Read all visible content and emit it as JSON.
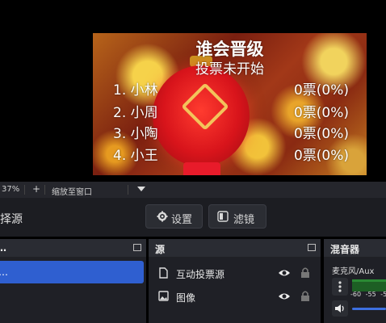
{
  "preview": {
    "title": "谁会晋级",
    "status": "投票未开始",
    "candidates": [
      {
        "name": "1. 小林",
        "count": "0票(0%)"
      },
      {
        "name": "2. 小周",
        "count": "0票(0%)"
      },
      {
        "name": "3. 小陶",
        "count": "0票(0%)"
      },
      {
        "name": "4. 小王",
        "count": "0票(0%)"
      }
    ]
  },
  "zoombar": {
    "zoom": "37%",
    "plus": "+",
    "fit_label": "缩放至窗口",
    "dropdown_icon": "triangle-down-icon"
  },
  "toolbar": {
    "partial_label": "择源",
    "settings_label": "设置",
    "filter_label": "滤镜"
  },
  "scenes_panel": {
    "partial_title": "…",
    "selected_partial": "…"
  },
  "sources_panel": {
    "title": "源",
    "items": [
      {
        "label": "互动投票源",
        "icon": "file-icon"
      },
      {
        "label": "图像",
        "icon": "image-icon"
      }
    ]
  },
  "mixer": {
    "title": "混音器",
    "channel": "麦克风/Aux",
    "ticks": [
      "-60",
      "-55",
      "-5"
    ]
  },
  "colors": {
    "selected": "#2f5fd0",
    "panel": "#1f2026",
    "header": "#2a2c33"
  }
}
